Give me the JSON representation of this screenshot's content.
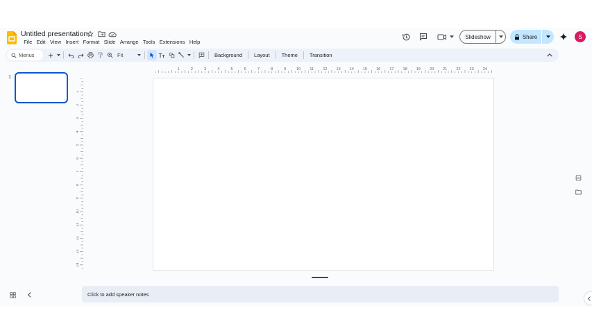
{
  "document": {
    "title": "Untitled presentation"
  },
  "menu": [
    "File",
    "Edit",
    "View",
    "Insert",
    "Format",
    "Slide",
    "Arrange",
    "Tools",
    "Extensions",
    "Help"
  ],
  "header": {
    "slideshow_label": "Slideshow",
    "share_label": "Share",
    "avatar_initial": "S"
  },
  "toolbar": {
    "search_label": "Menus",
    "zoom_value": "Fit",
    "background_label": "Background",
    "layout_label": "Layout",
    "theme_label": "Theme",
    "transition_label": "Transition"
  },
  "filmstrip": {
    "slides": [
      {
        "number": "1"
      }
    ]
  },
  "rulers": {
    "horizontal_labels": [
      "1",
      "2",
      "3",
      "4",
      "5",
      "6",
      "7",
      "8",
      "9",
      "10",
      "11",
      "12",
      "13",
      "14",
      "15",
      "16",
      "17",
      "18",
      "19",
      "20",
      "21",
      "22",
      "23",
      "24",
      "25"
    ],
    "vertical_labels": [
      "1",
      "2",
      "3",
      "4",
      "5",
      "6",
      "7",
      "8",
      "9",
      "10",
      "11",
      "12",
      "13",
      "14"
    ]
  },
  "notes": {
    "placeholder": "Click to add speaker notes"
  },
  "colors": {
    "accent": "#0b57d0",
    "share_button": "#c2e7ff",
    "avatar": "#d81b60",
    "toolbar_bg": "#edf2fa",
    "app_bg": "#f9fbfd"
  }
}
